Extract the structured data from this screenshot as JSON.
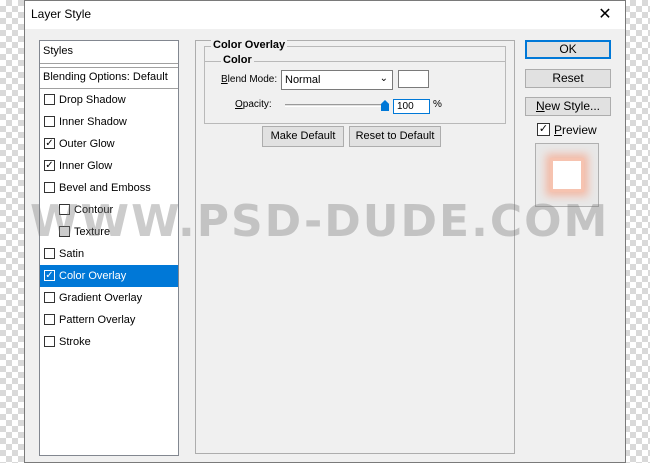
{
  "dialog": {
    "title": "Layer Style",
    "close_glyph": "✕"
  },
  "styles_panel": {
    "header": "Styles",
    "blending_options": "Blending Options: Default",
    "items": [
      {
        "label": "Drop Shadow",
        "checked": false,
        "indent": false,
        "selected": false
      },
      {
        "label": "Inner Shadow",
        "checked": false,
        "indent": false,
        "selected": false
      },
      {
        "label": "Outer Glow",
        "checked": true,
        "indent": false,
        "selected": false
      },
      {
        "label": "Inner Glow",
        "checked": true,
        "indent": false,
        "selected": false
      },
      {
        "label": "Bevel and Emboss",
        "checked": false,
        "indent": false,
        "selected": false
      },
      {
        "label": "Contour",
        "checked": false,
        "indent": true,
        "selected": false
      },
      {
        "label": "Texture",
        "checked": false,
        "indent": true,
        "selected": false
      },
      {
        "label": "Satin",
        "checked": false,
        "indent": false,
        "selected": false
      },
      {
        "label": "Color Overlay",
        "checked": true,
        "indent": false,
        "selected": true
      },
      {
        "label": "Gradient Overlay",
        "checked": false,
        "indent": false,
        "selected": false
      },
      {
        "label": "Pattern Overlay",
        "checked": false,
        "indent": false,
        "selected": false
      },
      {
        "label": "Stroke",
        "checked": false,
        "indent": false,
        "selected": false
      }
    ]
  },
  "color_overlay": {
    "section_title": "Color Overlay",
    "group_title": "Color",
    "blend_mode_label_underlined": "B",
    "blend_mode_label_rest": "lend Mode:",
    "blend_mode_value": "Normal",
    "overlay_color": "#ffffff",
    "opacity_label_underlined": "O",
    "opacity_label_rest": "pacity:",
    "opacity_value": "100",
    "opacity_unit": "%",
    "opacity_level": 1.0,
    "make_default_label": "Make Default",
    "reset_default_label": "Reset to Default"
  },
  "actions": {
    "ok_label": "OK",
    "reset_label": "Reset",
    "new_style_underlined": "N",
    "new_style_rest": "ew Style...",
    "preview_underlined": "P",
    "preview_rest": "review",
    "preview_checked": true
  },
  "watermark": {
    "text": "WWW.PSD-DUDE.COM"
  },
  "colors": {
    "accent": "#0078d7",
    "glow": "#f3b9a5"
  }
}
